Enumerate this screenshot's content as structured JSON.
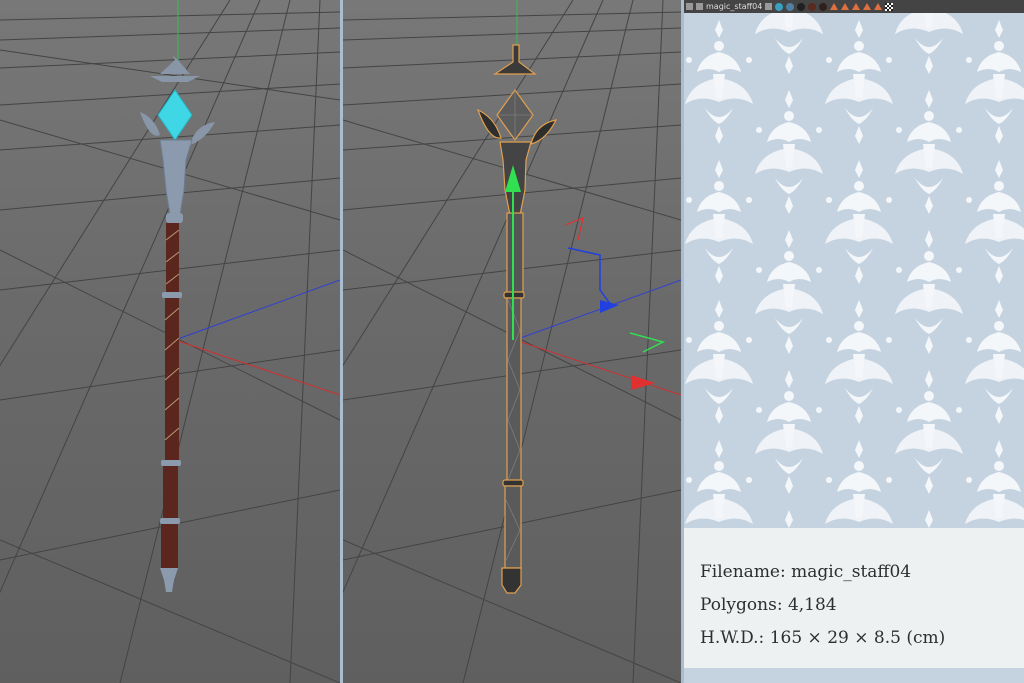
{
  "toolbar": {
    "scene_name": "magic_staff04",
    "icons": [
      "camera-icon",
      "light-icon",
      "render-icon",
      "sphere-icon",
      "cone-icon",
      "checker-icon"
    ],
    "sphere_colors": [
      "#3aa0c0",
      "#5080a0",
      "#202020",
      "#5a2a20",
      "#30201c"
    ],
    "cone_color": "#e07040"
  },
  "info": {
    "filename_label": "Filename: magic_staff04",
    "polygons_label": "Polygons: 4,184",
    "dimensions_label": "H.W.D.: 165 × 29 × 8.5 (cm)"
  },
  "colors": {
    "viewport_bg": "#6b6b6b",
    "grid": "#3f3f3f",
    "crystal": "#3fd6e6",
    "shaft_wood": "#5a261d",
    "metal": "#8c9aad",
    "wire_outline": "#e0a050",
    "axis_x": "#e03030",
    "axis_y": "#30e050",
    "axis_z": "#2040e0",
    "pattern_bg": "#c5d3e1",
    "pattern_fg": "#f4f7fa",
    "info_bg": "#edf1f1"
  }
}
